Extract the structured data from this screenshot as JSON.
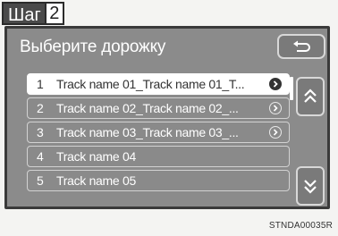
{
  "step": {
    "word": "Шаг",
    "number": "2"
  },
  "screen": {
    "title": "Выберите дорожку",
    "back_icon": "back-arrow-icon",
    "tracks": [
      {
        "num": "1",
        "label": "Track name 01_Track name 01_T...",
        "selected": true,
        "info": true
      },
      {
        "num": "2",
        "label": "Track name 02_Track name 02_...",
        "selected": false,
        "info": true
      },
      {
        "num": "3",
        "label": "Track name 03_Track name 03_...",
        "selected": false,
        "info": true
      },
      {
        "num": "4",
        "label": "Track name 04",
        "selected": false,
        "info": false
      },
      {
        "num": "5",
        "label": "Track name 05",
        "selected": false,
        "info": false
      }
    ],
    "scroll_up_icon": "double-chevron-up-icon",
    "scroll_down_icon": "double-chevron-down-icon"
  },
  "footer": {
    "code": "STNDA00035R"
  }
}
